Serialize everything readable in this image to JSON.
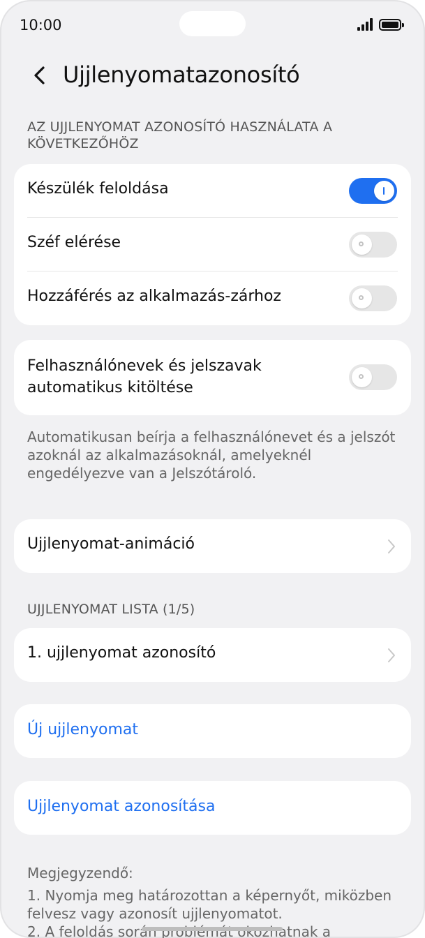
{
  "status_bar": {
    "time": "10:00"
  },
  "header": {
    "title": "Ujjlenyomatazonosító"
  },
  "usage_section": {
    "label": "AZ UJJLENYOMAT AZONOSÍTÓ HASZNÁLATA A KÖVETKEZŐHÖZ",
    "items": [
      {
        "label": "Készülék feloldása",
        "enabled": true
      },
      {
        "label": "Széf elérése",
        "enabled": false
      },
      {
        "label": "Hozzáférés az alkalmazás-zárhoz",
        "enabled": false
      }
    ]
  },
  "autofill": {
    "label": "Felhasználónevek és jelszavak automatikus kitöltése",
    "enabled": false,
    "description": "Automatikusan beírja a felhasználónevet és a jelszót azoknál az alkalmazásoknál, amelyeknél engedélyezve van a Jelszótároló."
  },
  "animation": {
    "label": "Ujjlenyomat-animáció"
  },
  "list_section": {
    "label": "UJJLENYOMAT LISTA (1/5)",
    "items": [
      {
        "label": "1. ujjlenyomat azonosító"
      }
    ]
  },
  "actions": {
    "new_label": "Új ujjlenyomat",
    "identify_label": "Ujjlenyomat azonosítása"
  },
  "note": {
    "title": "Megjegyzendő:",
    "line1": "1. Nyomja meg határozottan a képernyőt, miközben felvesz vagy azonosít ujjlenyomatot.",
    "line2": "2. A feloldás során problémát okozhatnak a"
  },
  "colors": {
    "accent": "#1f6ff0",
    "background": "#f1f1f3"
  }
}
